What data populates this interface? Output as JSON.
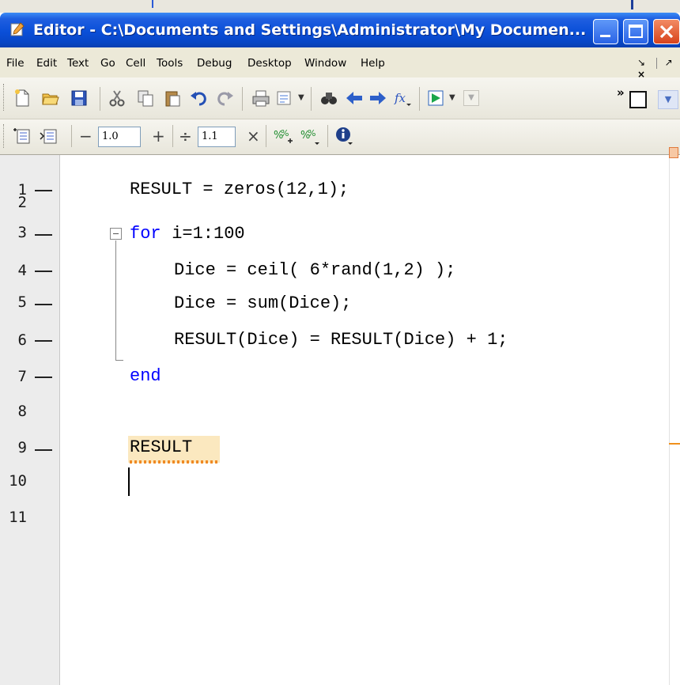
{
  "window": {
    "title": "Editor - C:\\Documents and Settings\\Administrator\\My Documen..."
  },
  "menu": {
    "items": [
      "File",
      "Edit",
      "Text",
      "Go",
      "Cell",
      "Tools",
      "Debug",
      "Desktop",
      "Window",
      "Help"
    ]
  },
  "toolbar1": {
    "icons": [
      "new-file-icon",
      "open-folder-icon",
      "save-icon",
      "cut-icon",
      "copy-icon",
      "paste-icon",
      "undo-icon",
      "redo-icon",
      "print-icon",
      "print-preview-icon",
      "find-icon",
      "back-icon",
      "forward-icon",
      "function-browser-icon",
      "run-icon",
      "stack-dropdown-icon"
    ]
  },
  "toolbar2": {
    "decrement_value": "1.0",
    "divide_value": "1.1",
    "minus_label": "−",
    "plus_label": "+",
    "divide_label": "÷",
    "times_label": "×"
  },
  "editor": {
    "lines": [
      {
        "num": "1",
        "code": "RESULT = zeros(12,1);",
        "breakpoint": true
      },
      {
        "num": "2",
        "code": "",
        "breakpoint": false
      },
      {
        "num": "3",
        "keyword": "for",
        "code": " i=1:100",
        "breakpoint": true
      },
      {
        "num": "4",
        "code": "Dice = ceil( 6*rand(1,2) );",
        "breakpoint": true
      },
      {
        "num": "5",
        "code": "Dice = sum(Dice);",
        "breakpoint": true
      },
      {
        "num": "6",
        "code": "RESULT(Dice) = RESULT(Dice) + 1;",
        "breakpoint": true
      },
      {
        "num": "7",
        "keyword": "end",
        "code": "",
        "breakpoint": true
      },
      {
        "num": "8",
        "code": "",
        "breakpoint": false
      },
      {
        "num": "9",
        "code": "RESULT",
        "breakpoint": true
      },
      {
        "num": "10",
        "code": "",
        "breakpoint": false
      },
      {
        "num": "11",
        "code": "",
        "breakpoint": false
      }
    ]
  },
  "colors": {
    "keyword": "#0000ff",
    "titlebar": "#0a4fd8",
    "highlight": "#fbe8bf",
    "warning": "#f0901c"
  }
}
